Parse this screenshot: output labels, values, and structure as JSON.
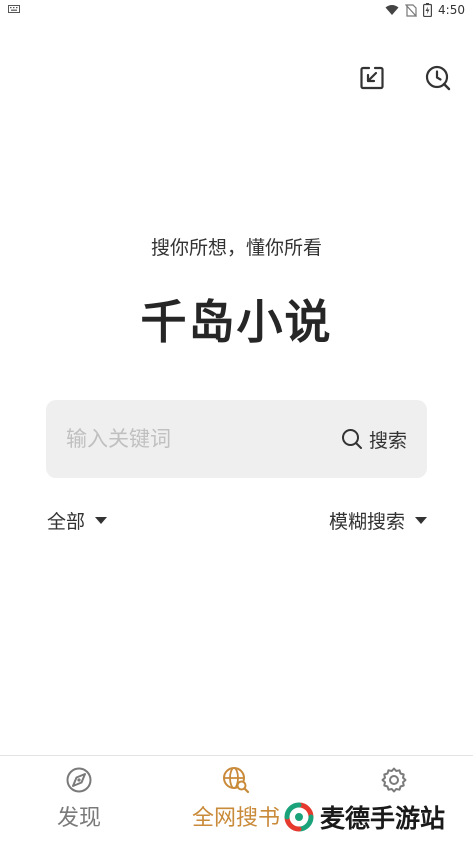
{
  "status_bar": {
    "time": "4:50",
    "icons": [
      "wifi-icon",
      "no-sim-icon",
      "battery-icon"
    ]
  },
  "toolbar": {
    "icons": [
      "download-icon",
      "history-icon"
    ]
  },
  "hero": {
    "tagline": "搜你所想，懂你所看",
    "app_title": "千岛小说"
  },
  "search": {
    "placeholder": "输入关键词",
    "value": "",
    "button_label": "搜索"
  },
  "filters": {
    "scope": "全部",
    "mode": "模糊搜索"
  },
  "bottom_nav": {
    "items": [
      {
        "label": "发现",
        "icon": "compass-icon",
        "active": false
      },
      {
        "label": "全网搜书",
        "icon": "globe-search-icon",
        "active": true
      },
      {
        "label": "设置",
        "icon": "gear-icon",
        "active": false
      }
    ]
  },
  "watermark": {
    "text": "麦德手游站"
  },
  "colors": {
    "accent": "#c98a3a",
    "nav_inactive": "#7a7a7a",
    "search_bg": "#efefef"
  }
}
